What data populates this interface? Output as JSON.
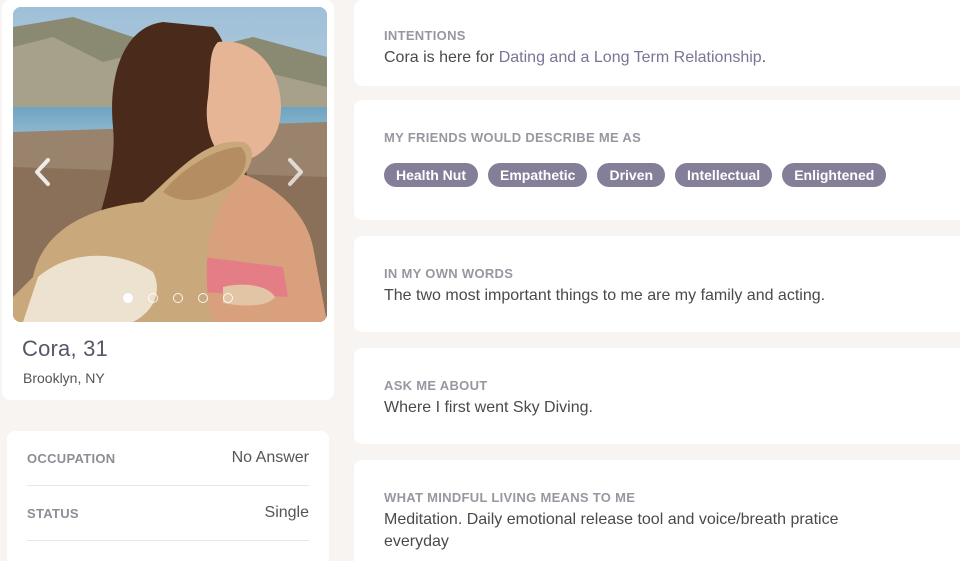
{
  "profile": {
    "name_age": "Cora, 31",
    "location": "Brooklyn, NY",
    "photo_icons": {
      "prev": "chevron-left-icon",
      "next": "chevron-right-icon"
    },
    "photo_dots": 5,
    "active_dot": 0
  },
  "details": [
    {
      "label": "OCCUPATION",
      "value": "No Answer"
    },
    {
      "label": "STATUS",
      "value": "Single"
    }
  ],
  "sections": {
    "intentions": {
      "title": "INTENTIONS",
      "text_prefix": "Cora is here for ",
      "highlight": "Dating and a Long Term Relationship",
      "text_suffix": "."
    },
    "friends": {
      "title": "MY FRIENDS WOULD DESCRIBE ME AS",
      "tags": [
        "Health Nut",
        "Empathetic",
        "Driven",
        "Intellectual",
        "Enlightened"
      ]
    },
    "own_words": {
      "title": "IN MY OWN WORDS",
      "text": "The two most important things to me are my family and acting."
    },
    "ask_me": {
      "title": "ASK ME ABOUT",
      "text": "Where I first went Sky Diving."
    },
    "mindful": {
      "title": "WHAT MINDFUL LIVING MEANS TO ME",
      "text": "Meditation. Daily emotional release tool and voice/breath pratice everyday"
    }
  },
  "colors": {
    "accent": "#857e98",
    "link": "#7c7397",
    "background": "#f7f4f1"
  }
}
